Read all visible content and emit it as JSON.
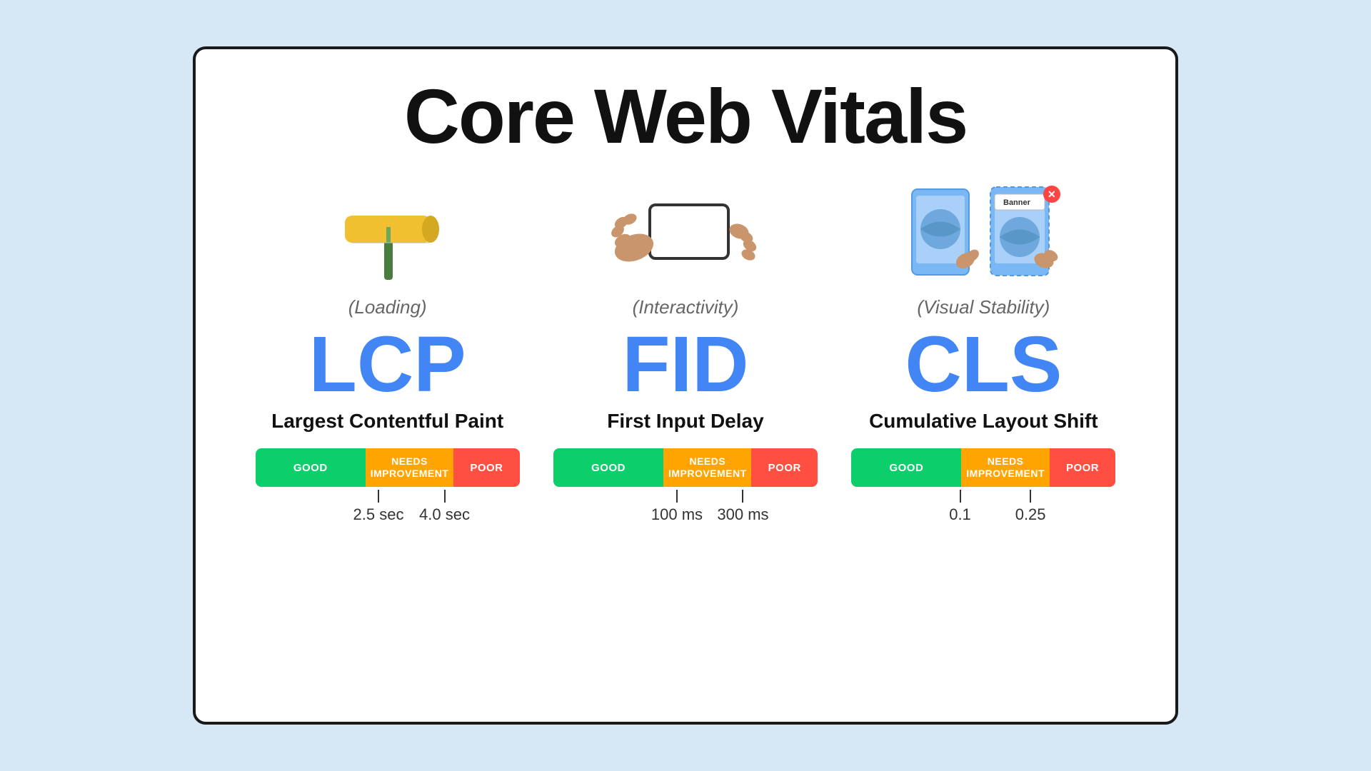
{
  "title": "Core Web Vitals",
  "vitals": [
    {
      "abbr": "LCP",
      "name": "Largest Contentful Paint",
      "category": "(Loading)",
      "icon_type": "paint-roller",
      "good_label": "GOOD",
      "needs_label": "NEEDS\nIMPROVEMENT",
      "poor_label": "POOR",
      "marker1": "2.5 sec",
      "marker2": "4.0 sec",
      "marker1_pct": 37,
      "marker2_pct": 62
    },
    {
      "abbr": "FID",
      "name": "First Input Delay",
      "category": "(Interactivity)",
      "icon_type": "phone-tap",
      "good_label": "GOOD",
      "needs_label": "NEEDS\nIMPROVEMENT",
      "poor_label": "POOR",
      "marker1": "100 ms",
      "marker2": "300 ms",
      "marker1_pct": 37,
      "marker2_pct": 62
    },
    {
      "abbr": "CLS",
      "name": "Cumulative Layout Shift",
      "category": "(Visual Stability)",
      "icon_type": "layout-shift",
      "good_label": "GOOD",
      "needs_label": "NEEDS\nIMPROVEMENT",
      "poor_label": "POOR",
      "marker1": "0.1",
      "marker2": "0.25",
      "marker1_pct": 37,
      "marker2_pct": 62
    }
  ]
}
